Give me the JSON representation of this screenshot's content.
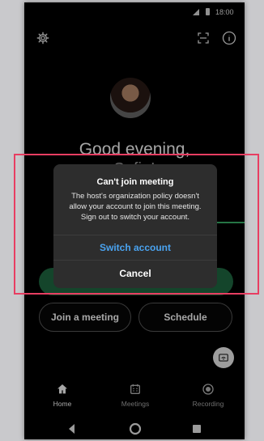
{
  "status_bar": {
    "time": "18:00"
  },
  "header": {
    "settings_icon": "gear-icon",
    "scan_icon": "scan-icon",
    "info_icon": "info-icon"
  },
  "greeting": {
    "line1": "Good evening,",
    "line2": "Sofia!"
  },
  "dialog": {
    "title": "Can't join meeting",
    "message": "The host's organization policy doesn't allow your account to join this meeting. Sign out to switch your account.",
    "switch_label": "Switch account",
    "cancel_label": "Cancel"
  },
  "actions": {
    "join_label": "Join a meeting",
    "schedule_label": "Schedule"
  },
  "bottom_nav": [
    {
      "label": "Home",
      "icon": "home-icon"
    },
    {
      "label": "Meetings",
      "icon": "calendar-icon"
    },
    {
      "label": "Recording",
      "icon": "record-icon"
    }
  ],
  "colors": {
    "accent_blue": "#4aa3f0",
    "green": "#1f6b43",
    "highlight_red": "#e83e62"
  }
}
